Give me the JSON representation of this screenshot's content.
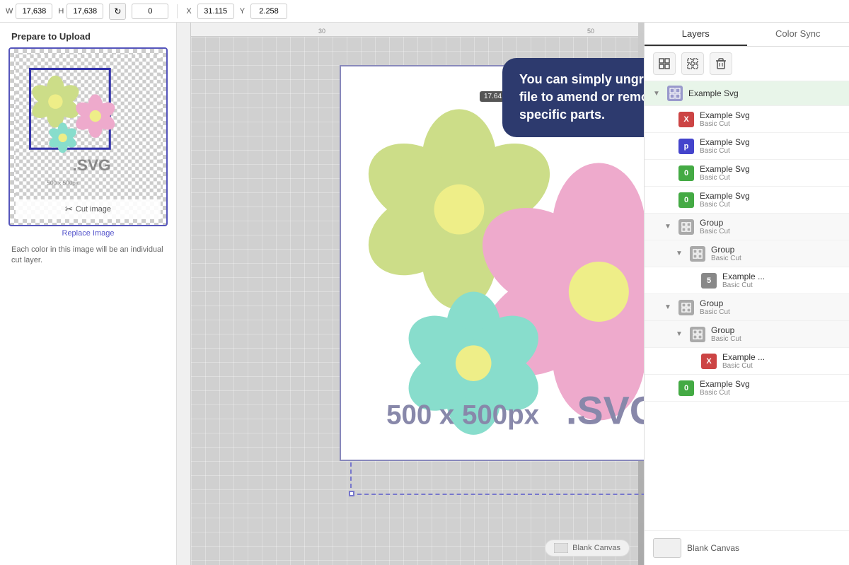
{
  "toolbar": {
    "w_label": "W",
    "h_label": "H",
    "w_value": "17,638",
    "h_value": "17,638",
    "rotate_value": "0",
    "x_label": "X",
    "y_label": "Y",
    "x_value": "31.115",
    "y_value": "2.258"
  },
  "tabs": {
    "layers_label": "Layers",
    "color_sync_label": "Color Sync"
  },
  "tooltip": {
    "text": "You can simply ungroup the file to amend or remove specific parts."
  },
  "dimension_badge": "17.64",
  "left_panel": {
    "title": "Prepare to Upload",
    "cut_image_label": "Cut image",
    "replace_label": "Replace Image",
    "description": "Each color in this image will be an individual cut layer."
  },
  "ruler_marks": [
    "30",
    "50"
  ],
  "layers": [
    {
      "id": "top",
      "indent": 0,
      "expandable": true,
      "icon_type": "group-img",
      "name": "Example Svg",
      "type": "",
      "highlighted": true
    },
    {
      "id": "l1",
      "indent": 1,
      "expandable": false,
      "icon_type": "x",
      "name": "Example Svg",
      "type": "Basic Cut"
    },
    {
      "id": "l2",
      "indent": 1,
      "expandable": false,
      "icon_type": "p",
      "name": "Example Svg",
      "type": "Basic Cut"
    },
    {
      "id": "l3",
      "indent": 1,
      "expandable": false,
      "icon_type": "o",
      "name": "Example Svg",
      "type": "Basic Cut"
    },
    {
      "id": "l4",
      "indent": 1,
      "expandable": false,
      "icon_type": "o",
      "name": "Example Svg",
      "type": "Basic Cut"
    },
    {
      "id": "g1",
      "indent": 1,
      "expandable": true,
      "icon_type": "group",
      "name": "Group",
      "type": "Basic Cut"
    },
    {
      "id": "g2",
      "indent": 2,
      "expandable": true,
      "icon_type": "group",
      "name": "Group",
      "type": "Basic Cut"
    },
    {
      "id": "l5",
      "indent": 3,
      "expandable": false,
      "icon_type": "5",
      "name": "Example ...",
      "type": "Basic Cut"
    },
    {
      "id": "g3",
      "indent": 1,
      "expandable": true,
      "icon_type": "group",
      "name": "Group",
      "type": "Basic Cut"
    },
    {
      "id": "g4",
      "indent": 2,
      "expandable": true,
      "icon_type": "group",
      "name": "Group",
      "type": "Basic Cut"
    },
    {
      "id": "l6",
      "indent": 3,
      "expandable": false,
      "icon_type": "x",
      "name": "Example ...",
      "type": "Basic Cut"
    },
    {
      "id": "l7",
      "indent": 1,
      "expandable": false,
      "icon_type": "o",
      "name": "Example Svg",
      "type": "Basic Cut"
    }
  ],
  "blank_canvas_label": "Blank Canvas",
  "panel_tools": {
    "group_icon": "⊞",
    "ungroup_icon": "⊟",
    "delete_icon": "🗑"
  },
  "artwork": {
    "size_label": "500 x 500px",
    "ext_label": ".SVG"
  }
}
